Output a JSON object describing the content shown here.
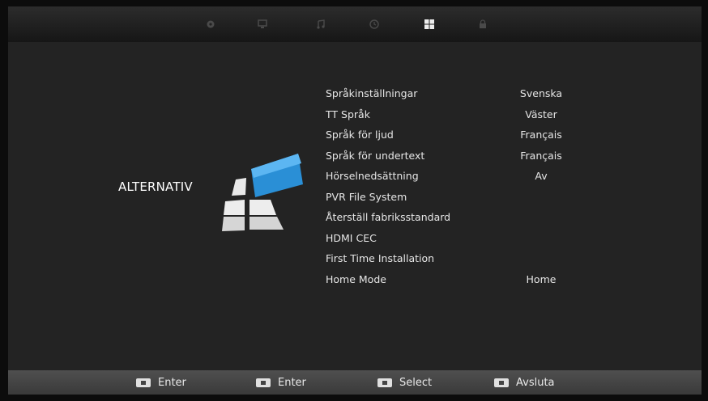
{
  "tabs": [
    {
      "icon": "gear-icon"
    },
    {
      "icon": "monitor-icon"
    },
    {
      "icon": "music-note-icon"
    },
    {
      "icon": "clock-icon"
    },
    {
      "icon": "grid-icon",
      "active": true
    },
    {
      "icon": "lock-icon"
    }
  ],
  "page": {
    "title": "ALTERNATIV"
  },
  "menu": {
    "items": [
      {
        "label": "Språkinställningar",
        "value": "Svenska"
      },
      {
        "label": "TT Språk",
        "value": "Väster"
      },
      {
        "label": "Språk för ljud",
        "value": "Français"
      },
      {
        "label": "Språk för undertext",
        "value": "Français"
      },
      {
        "label": "Hörselnedsättning",
        "value": "Av"
      },
      {
        "label": "PVR File System",
        "value": ""
      },
      {
        "label": "Återställ fabriksstandard",
        "value": ""
      },
      {
        "label": "HDMI CEC",
        "value": ""
      },
      {
        "label": "First Time Installation",
        "value": ""
      },
      {
        "label": "Home Mode",
        "value": "Home"
      }
    ]
  },
  "footer": {
    "hints": [
      {
        "key_icon": "ok-key-icon",
        "label": "Enter"
      },
      {
        "key_icon": "right-key-icon",
        "label": "Enter"
      },
      {
        "key_icon": "updown-key-icon",
        "label": "Select"
      },
      {
        "key_icon": "exit-key-icon",
        "label": "Avsluta"
      }
    ]
  },
  "colors": {
    "accent": "#2a8fd6",
    "background": "#232323",
    "footer": "#474747"
  }
}
